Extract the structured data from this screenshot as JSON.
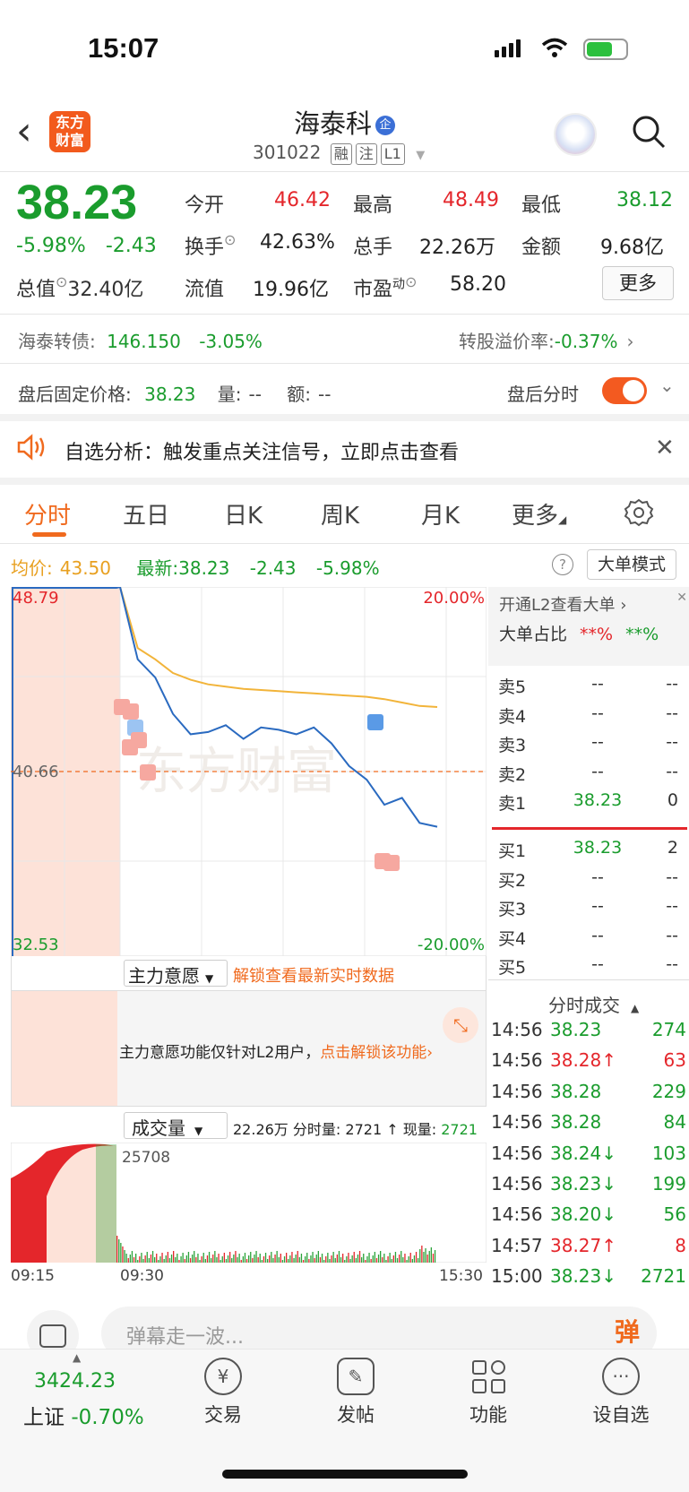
{
  "status_bar": {
    "time": "15:07"
  },
  "header": {
    "logo_text": "东方财富",
    "stock_name": "海泰科",
    "badge": "企",
    "code": "301022",
    "tags": [
      "融",
      "注",
      "L1"
    ]
  },
  "quote": {
    "price": "38.23",
    "change_pct": "-5.98%",
    "change": "-2.43",
    "open_label": "今开",
    "open": "46.42",
    "high_label": "最高",
    "high": "48.49",
    "low_label": "最低",
    "low": "38.12",
    "turnover_label": "换手",
    "turnover": "42.63%",
    "volume_label": "总手",
    "volume": "22.26万",
    "amount_label": "金额",
    "amount": "9.68亿",
    "mktcap_label": "总值",
    "mktcap": "32.40亿",
    "float_label": "流值",
    "float_val": "19.96亿",
    "pe_label": "市盈",
    "pe_sup": "动",
    "pe": "58.20",
    "more": "更多"
  },
  "bond": {
    "label": "海泰转债:",
    "price": "146.150",
    "pct": "-3.05%",
    "premium_label": "转股溢价率:",
    "premium": "-0.37%"
  },
  "after_hours": {
    "label": "盘后固定价格:",
    "price": "38.23",
    "vol_label": "量:",
    "vol": "--",
    "amt_label": "额:",
    "amt": "--",
    "toggle_label": "盘后分时"
  },
  "alert": {
    "text": "自选分析：触发重点关注信号，立即点击查看"
  },
  "tabs": [
    "分时",
    "五日",
    "日K",
    "周K",
    "月K",
    "更多"
  ],
  "summary": {
    "avg_label": "均价:",
    "avg": "43.50",
    "latest_label": "最新:",
    "latest": "38.23",
    "chg": "-2.43",
    "pct": "-5.98%",
    "mode_btn": "大单模式"
  },
  "chart_labels": {
    "top_price": "48.79",
    "mid_price": "40.66",
    "bottom_price": "32.53",
    "top_pct": "20.00%",
    "bottom_pct": "-20.00%",
    "watermark": "东方财富",
    "vol_max": "25708",
    "time_start": "09:15",
    "time_mid": "09:30",
    "time_end": "15:30"
  },
  "chart_data": {
    "type": "line",
    "xlabel": "",
    "ylabel": "",
    "ylim": [
      32.53,
      48.79
    ],
    "x": [
      "09:30",
      "09:35",
      "09:45",
      "10:00",
      "10:15",
      "10:30",
      "10:45",
      "11:00",
      "11:15",
      "11:30",
      "13:00",
      "13:15",
      "13:30",
      "13:45",
      "14:00",
      "14:15",
      "14:30",
      "14:45",
      "15:00"
    ],
    "series": [
      {
        "values": [
          48.79,
          45.6,
          44.8,
          43.2,
          42.3,
          42.4,
          42.7,
          42.1,
          42.6,
          42.5,
          42.3,
          42.6,
          41.9,
          40.9,
          40.3,
          39.2,
          39.5,
          38.4,
          38.23
        ]
      },
      {
        "values": [
          48.79,
          46.1,
          45.6,
          45.0,
          44.7,
          44.5,
          44.4,
          44.3,
          44.25,
          44.2,
          44.15,
          44.1,
          44.05,
          44.0,
          43.95,
          43.85,
          43.7,
          43.55,
          43.5
        ]
      }
    ]
  },
  "main_force": {
    "label": "主力意愿",
    "unlock": "解锁查看最新实时数据",
    "notice": "主力意愿功能仅针对L2用户，",
    "notice_link": "点击解锁该功能"
  },
  "volume": {
    "label": "成交量",
    "total": "22.26万",
    "slot_label": "分时量:",
    "slot": "2721",
    "now_label": "现量:",
    "now": "2721"
  },
  "side": {
    "l2": "开通L2查看大单",
    "ratio_label": "大单占比",
    "ratio1": "**%",
    "ratio2": "**%",
    "asks": [
      {
        "n": "卖5",
        "p": "--",
        "v": "--"
      },
      {
        "n": "卖4",
        "p": "--",
        "v": "--"
      },
      {
        "n": "卖3",
        "p": "--",
        "v": "--"
      },
      {
        "n": "卖2",
        "p": "--",
        "v": "--"
      },
      {
        "n": "卖1",
        "p": "38.23",
        "v": "0"
      }
    ],
    "bids": [
      {
        "n": "买1",
        "p": "38.23",
        "v": "2"
      },
      {
        "n": "买2",
        "p": "--",
        "v": "--"
      },
      {
        "n": "买3",
        "p": "--",
        "v": "--"
      },
      {
        "n": "买4",
        "p": "--",
        "v": "--"
      },
      {
        "n": "买5",
        "p": "--",
        "v": "--"
      }
    ],
    "trades_title": "分时成交",
    "trades": [
      {
        "t": "14:56",
        "p": "38.23",
        "a": "",
        "v": "274",
        "c": "green"
      },
      {
        "t": "14:56",
        "p": "38.28",
        "a": "↑",
        "v": "63",
        "c": "red"
      },
      {
        "t": "14:56",
        "p": "38.28",
        "a": "",
        "v": "229",
        "c": "green"
      },
      {
        "t": "14:56",
        "p": "38.28",
        "a": "",
        "v": "84",
        "c": "green"
      },
      {
        "t": "14:56",
        "p": "38.24",
        "a": "↓",
        "v": "103",
        "c": "green"
      },
      {
        "t": "14:56",
        "p": "38.23",
        "a": "↓",
        "v": "199",
        "c": "green"
      },
      {
        "t": "14:56",
        "p": "38.20",
        "a": "↓",
        "v": "56",
        "c": "green"
      },
      {
        "t": "14:57",
        "p": "38.27",
        "a": "↑",
        "v": "8",
        "c": "red"
      },
      {
        "t": "15:00",
        "p": "38.23",
        "a": "↓",
        "v": "2721",
        "c": "green"
      }
    ]
  },
  "danmu": {
    "placeholder": "弹幕走一波...",
    "btn": "弹"
  },
  "nav": {
    "index_value": "3424.23",
    "index_name": "上证",
    "index_pct": "-0.70%",
    "items": [
      "交易",
      "发帖",
      "功能",
      "设自选"
    ]
  }
}
